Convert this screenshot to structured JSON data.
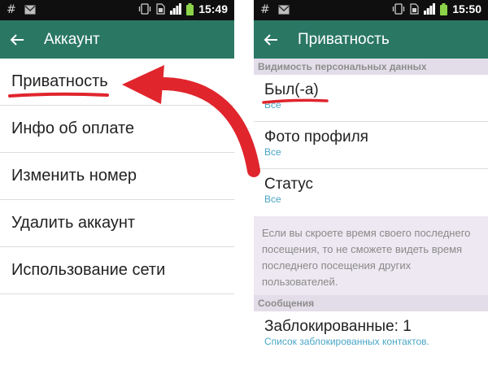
{
  "left": {
    "status": {
      "hash": "#",
      "time": "15:49"
    },
    "title": "Аккаунт",
    "items": [
      {
        "label": "Приватность"
      },
      {
        "label": "Инфо об оплате"
      },
      {
        "label": "Изменить номер"
      },
      {
        "label": "Удалить аккаунт"
      },
      {
        "label": "Использование сети"
      }
    ]
  },
  "right": {
    "status": {
      "hash": "#",
      "time": "15:50"
    },
    "title": "Приватность",
    "section1": "Видимость персональных данных",
    "prefs": [
      {
        "title": "Был(-а)",
        "value": "Все"
      },
      {
        "title": "Фото профиля",
        "value": "Все"
      },
      {
        "title": "Статус",
        "value": "Все"
      }
    ],
    "note": "Если вы скроете время своего последнего посещения, то не сможете видеть время последнего посещения других пользователей.",
    "section2": "Сообщения",
    "blocked": {
      "title": "Заблокированные: 1",
      "subtitle": "Список заблокированных контактов."
    }
  },
  "colors": {
    "appbar": "#2a7764",
    "statusbar": "#0f0f0f",
    "annotation": "#e0252d",
    "link": "#4aa6c6"
  }
}
